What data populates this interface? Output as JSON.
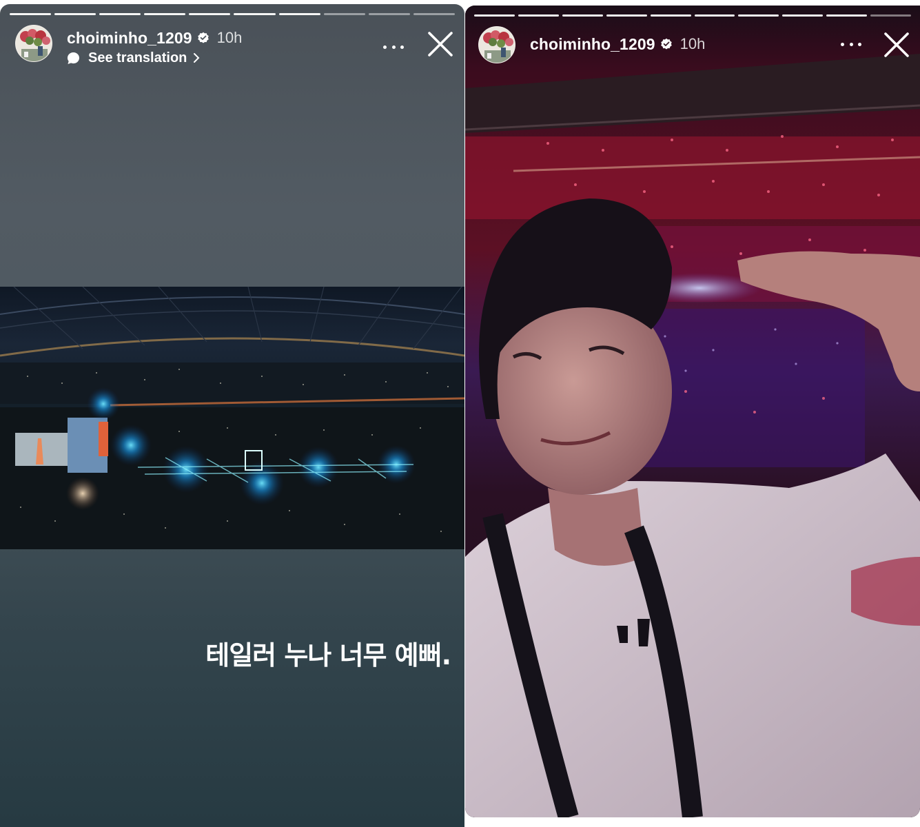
{
  "stories": [
    {
      "username": "choiminho_1209",
      "time": "10h",
      "translation_label": "See translation",
      "caption": "테일러 누나 너무 예뻐.",
      "progress_total": 10,
      "progress_done": 7
    },
    {
      "username": "choiminho_1209",
      "time": "10h",
      "progress_total": 10,
      "progress_done": 9
    }
  ],
  "icons": {
    "verified": "verified-badge-icon",
    "translate": "chat-bubble-icon",
    "more": "more-options-icon",
    "close": "close-icon"
  }
}
